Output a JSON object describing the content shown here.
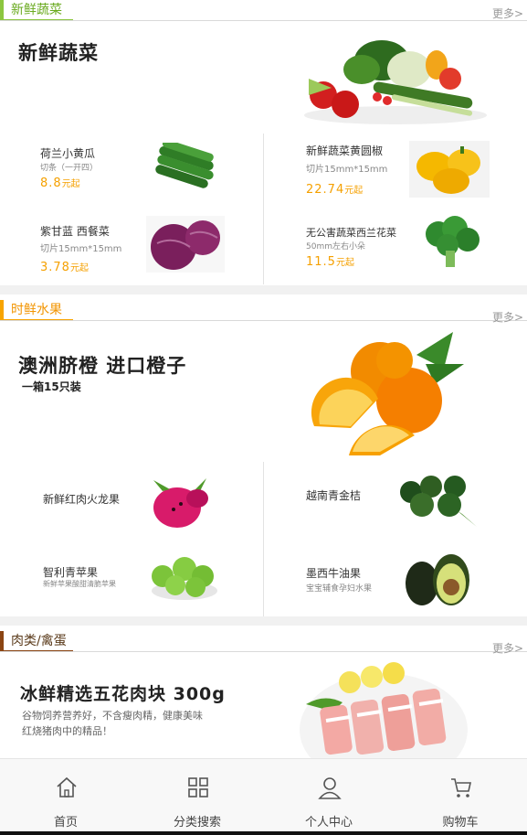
{
  "colors": {
    "veg_accent": "#8cc63f",
    "fruit_accent": "#f7a400",
    "meat_accent": "#8b4513",
    "price": "#f5a000",
    "more": "#999999"
  },
  "sections": [
    {
      "title": "新鲜蔬菜",
      "more": "更多>",
      "hero": {
        "title": "新鲜蔬菜",
        "image_icon": "vegetables-image"
      },
      "products": [
        {
          "name": "荷兰小黄瓜",
          "spec": "切条（一开四）",
          "price": "8.8",
          "unit": "元起",
          "image_icon": "cucumber-image"
        },
        {
          "name": "新鲜蔬菜黄圆椒",
          "spec": "切片15mm*15mm",
          "price": "22.74",
          "unit": "元起",
          "image_icon": "yellow-pepper-image"
        },
        {
          "name": "紫甘蓝 西餐菜",
          "spec": "切片15mm*15mm",
          "price": "3.78",
          "unit": "元起",
          "image_icon": "red-cabbage-image"
        },
        {
          "name": "无公害蔬菜西兰花菜",
          "spec": "50mm左右小朵",
          "price": "11.5",
          "unit": "元起",
          "image_icon": "broccoli-image"
        }
      ]
    },
    {
      "title": "时鲜水果",
      "more": "更多>",
      "hero": {
        "title": "澳洲脐橙  进口橙子",
        "subtitle": "一箱15只装",
        "image_icon": "oranges-image"
      },
      "products": [
        {
          "name": "新鲜红肉火龙果",
          "spec": "",
          "image_icon": "dragon-fruit-image"
        },
        {
          "name": "越南青金桔",
          "spec": "",
          "image_icon": "green-kumquat-image"
        },
        {
          "name": "智利青苹果",
          "spec": "新鲜苹果酸甜清脆苹果",
          "image_icon": "green-apple-image"
        },
        {
          "name": "墨西牛油果",
          "spec": "宝宝辅食孕妇水果",
          "image_icon": "avocado-image"
        }
      ]
    },
    {
      "title": "肉类/禽蛋",
      "more": "更多>",
      "hero": {
        "title": "冰鲜精选五花肉块  300g",
        "desc_line1": "谷物饲养营养好，不含瘦肉精，健康美味",
        "desc_line2": "红烧猪肉中的精品！",
        "image_icon": "pork-belly-image"
      }
    }
  ],
  "tabbar": [
    {
      "label": "首页",
      "icon": "home-icon"
    },
    {
      "label": "分类搜索",
      "icon": "grid-icon"
    },
    {
      "label": "个人中心",
      "icon": "user-icon"
    },
    {
      "label": "购物车",
      "icon": "cart-icon"
    }
  ]
}
